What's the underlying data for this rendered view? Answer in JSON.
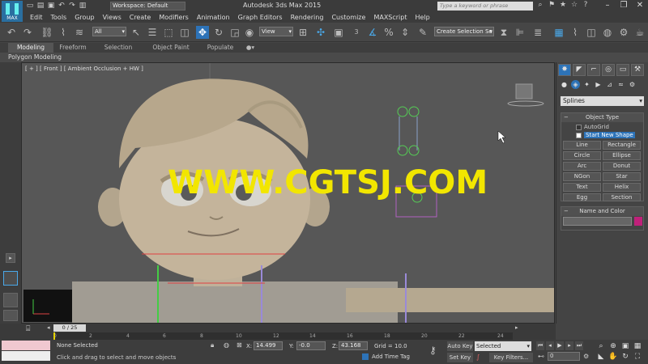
{
  "title_bar": {
    "workspace": "Workspace: Default",
    "window_title": "Autodesk 3ds Max  2015",
    "search_placeholder": "Type a keyword or phrase",
    "app_logo": "MAX"
  },
  "menu": [
    "Edit",
    "Tools",
    "Group",
    "Views",
    "Create",
    "Modifiers",
    "Animation",
    "Graph Editors",
    "Rendering",
    "Customize",
    "MAXScript",
    "Help"
  ],
  "toolbar": {
    "selection_filter": "All",
    "ref_coord": "View",
    "named_selection": "Create Selection Se",
    "snap_label": "3"
  },
  "ribbon": {
    "tabs": [
      "Modeling",
      "Freeform",
      "Selection",
      "Object Paint",
      "Populate"
    ],
    "active_tab": "Modeling",
    "sub_label": "Polygon Modeling"
  },
  "viewport": {
    "label": "[ + ] [ Front ] [ Ambient Occlusion + HW ]",
    "watermark": "WWW.CGTSJ.COM"
  },
  "command_panel": {
    "category": "Splines",
    "object_type_title": "Object Type",
    "autogrid": "AutoGrid",
    "start_new_shape": "Start New Shape",
    "buttons": [
      "Line",
      "Rectangle",
      "Circle",
      "Ellipse",
      "Arc",
      "Donut",
      "NGon",
      "Star",
      "Text",
      "Helix",
      "Egg",
      "Section"
    ],
    "name_color_title": "Name and Color",
    "swatch_color": "#c0207a"
  },
  "timeline": {
    "frame_display": "0 / 25",
    "ticks": [
      0,
      2,
      4,
      6,
      8,
      10,
      12,
      14,
      16,
      18,
      20,
      22,
      24
    ]
  },
  "status": {
    "selection": "None Selected",
    "prompt": "Click and drag to select and move objects",
    "x_label": "X:",
    "x": "14.499",
    "y_label": "Y:",
    "y": "-0.0",
    "z_label": "Z:",
    "z": "43.168",
    "grid": "Grid = 10.0",
    "add_time_tag": "Add Time Tag",
    "auto_key": "Auto Key",
    "set_key": "Set Key",
    "key_mode": "Selected",
    "key_filters": "Key Filters...",
    "frame": "0"
  }
}
